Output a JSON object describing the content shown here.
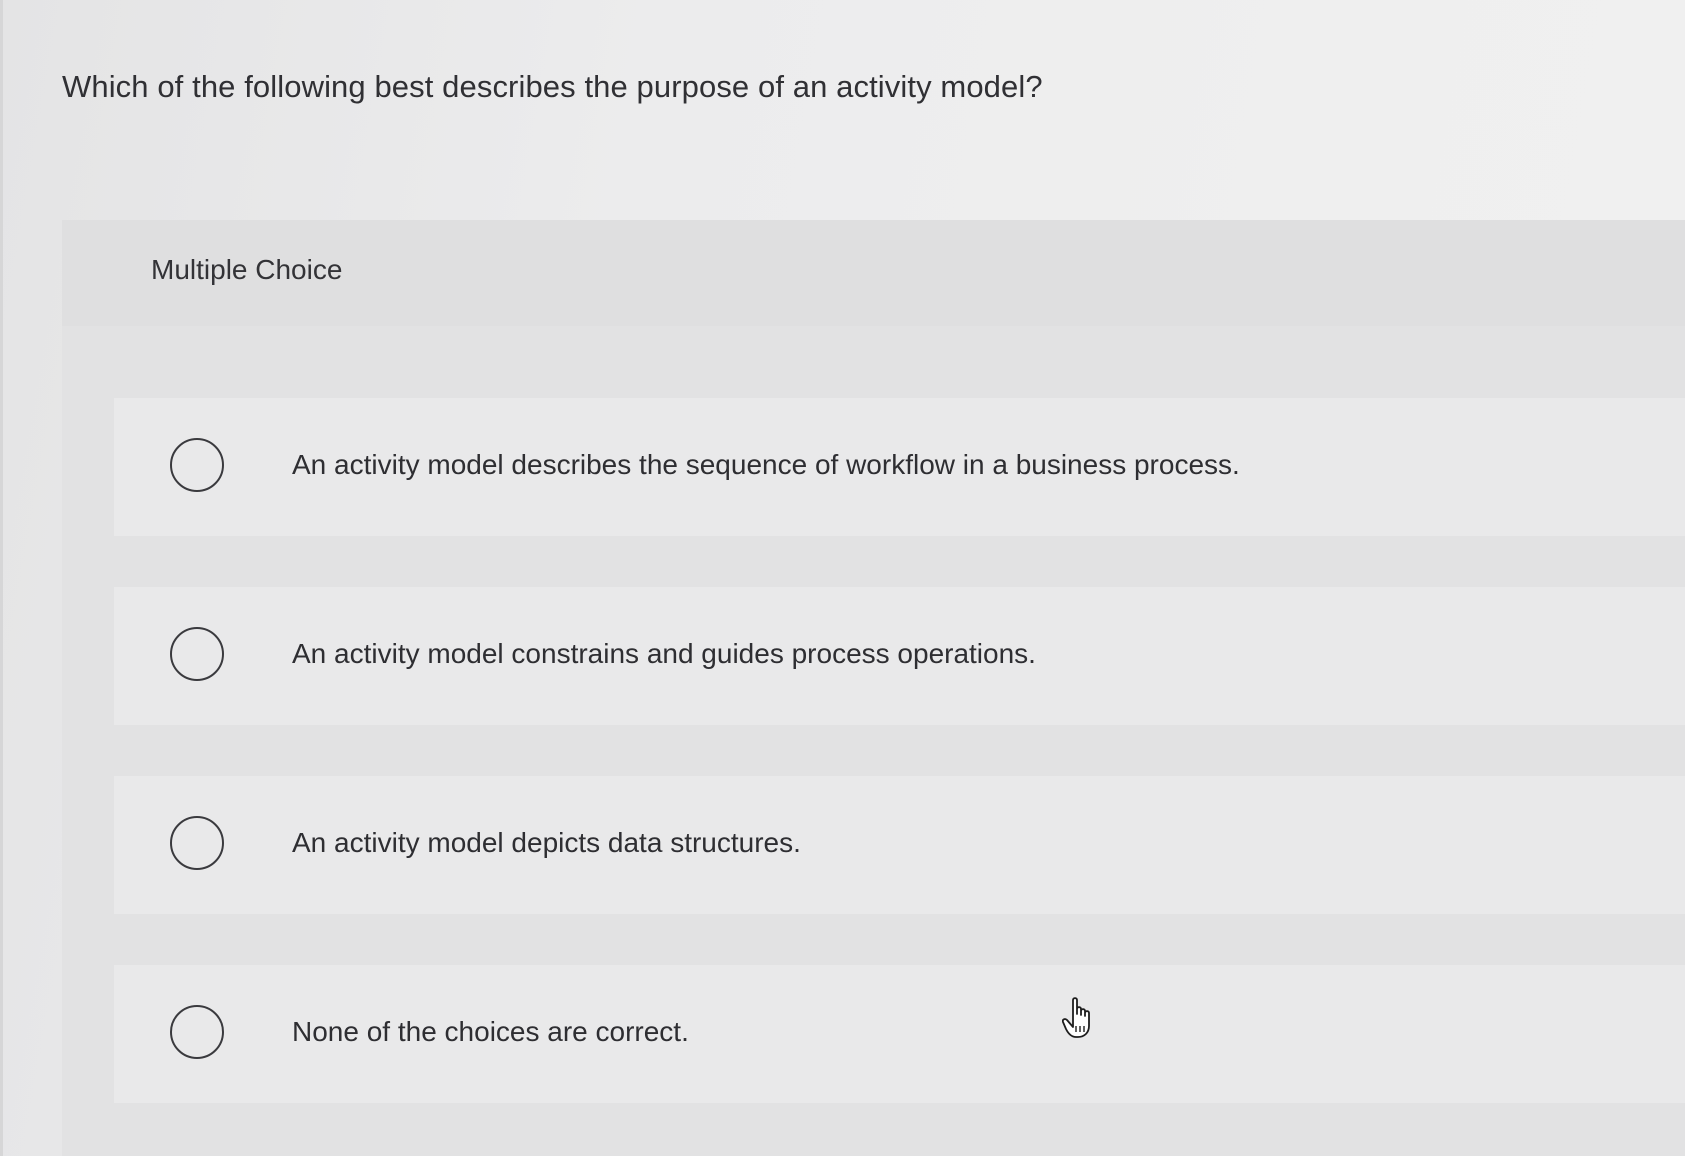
{
  "question": {
    "text": "Which of the following best describes the purpose of an activity model?"
  },
  "question_type": {
    "label": "Multiple Choice"
  },
  "options": [
    {
      "text": "An activity model describes the sequence of workflow in a business process.",
      "selected": false
    },
    {
      "text": "An activity model constrains and guides process operations.",
      "selected": false
    },
    {
      "text": "An activity model depicts data structures.",
      "selected": false
    },
    {
      "text": "None of the choices are correct.",
      "selected": false
    }
  ],
  "icons": {
    "radio": "radio-unchecked-icon",
    "cursor": "hand-pointer-icon"
  }
}
